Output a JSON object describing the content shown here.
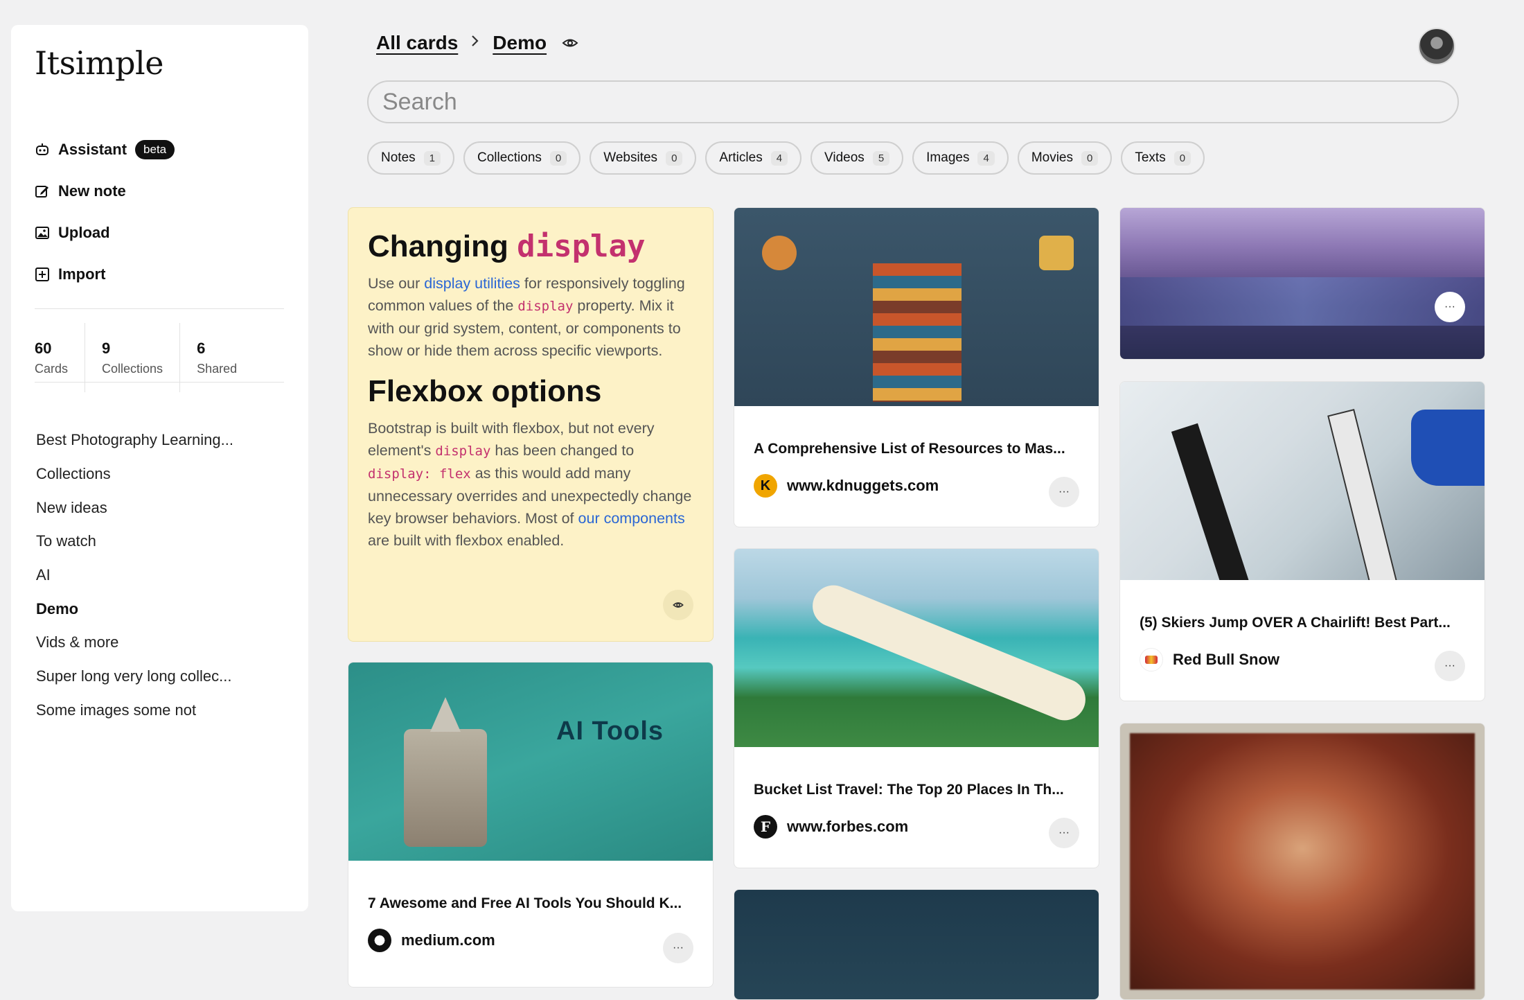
{
  "app": {
    "logo": "Itsimple"
  },
  "sidebar": {
    "nav": [
      {
        "label": "Assistant",
        "icon": "assistant-icon",
        "badge": "beta"
      },
      {
        "label": "New note",
        "icon": "edit-icon"
      },
      {
        "label": "Upload",
        "icon": "image-icon"
      },
      {
        "label": "Import",
        "icon": "plus-square-icon"
      }
    ],
    "stats": [
      {
        "value": "60",
        "label": "Cards"
      },
      {
        "value": "9",
        "label": "Collections"
      },
      {
        "value": "6",
        "label": "Shared"
      }
    ],
    "collections": [
      {
        "label": "Best Photography Learning..."
      },
      {
        "label": "Collections"
      },
      {
        "label": "New ideas"
      },
      {
        "label": "To watch"
      },
      {
        "label": "AI"
      },
      {
        "label": "Demo"
      },
      {
        "label": "Vids & more"
      },
      {
        "label": "Super long very long collec..."
      },
      {
        "label": "Some images some not"
      }
    ],
    "active_collection": "Demo"
  },
  "header": {
    "breadcrumb_root": "All cards",
    "breadcrumb_current": "Demo",
    "search_placeholder": "Search"
  },
  "filters": [
    {
      "label": "Notes",
      "count": "1"
    },
    {
      "label": "Collections",
      "count": "0"
    },
    {
      "label": "Websites",
      "count": "0"
    },
    {
      "label": "Articles",
      "count": "4"
    },
    {
      "label": "Videos",
      "count": "5"
    },
    {
      "label": "Images",
      "count": "4"
    },
    {
      "label": "Movies",
      "count": "0"
    },
    {
      "label": "Texts",
      "count": "0"
    }
  ],
  "note": {
    "h1_text": "Changing",
    "h1_code": "display",
    "p1_a": "Use our",
    "p1_link": "display utilities",
    "p1_b": "for responsively toggling common values of the",
    "p1_code": "display",
    "p1_c": "property. Mix it with our grid system, content, or components to show or hide them across specific viewports.",
    "h2": "Flexbox options",
    "p2_a": "Bootstrap is built with flexbox, but not every element's",
    "p2_code1": "display",
    "p2_b": "has been changed to",
    "p2_code2": "display: flex",
    "p2_c": "as this would add many unnecessary overrides and unexpectedly change key browser behaviors. Most of",
    "p2_link": "our components",
    "p2_d": "are built with flexbox enabled."
  },
  "cards": [
    {
      "title": "A Comprehensive List of Resources to Mas...",
      "source": "www.kdnuggets.com",
      "more": "···"
    },
    {
      "title": "Bucket List Travel: The Top 20 Places In Th...",
      "source": "www.forbes.com",
      "more": "···"
    },
    {
      "title": "7 Awesome and Free AI Tools You Should K...",
      "source": "medium.com",
      "more": "···",
      "image_text": "AI Tools"
    },
    {
      "title": "(5) Skiers Jump OVER A Chairlift! Best Part...",
      "source": "Red Bull Snow",
      "more": "···"
    }
  ],
  "image_more": "···",
  "favicons": {
    "kdnuggets": "K",
    "forbes": "F"
  },
  "colors": {
    "accent_link": "#2a66d4",
    "code_pink": "#c3316e",
    "note_bg": "#fdf2c7"
  }
}
